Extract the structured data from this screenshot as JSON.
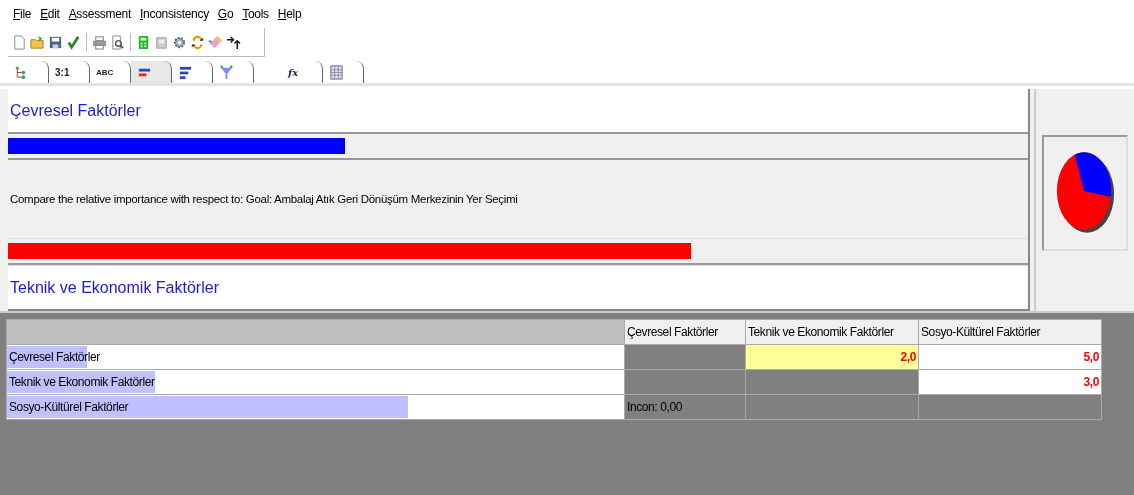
{
  "menu": [
    {
      "label": "File"
    },
    {
      "label": "Edit"
    },
    {
      "label": "Assessment"
    },
    {
      "label": "Inconsistency"
    },
    {
      "label": "Go"
    },
    {
      "label": "Tools"
    },
    {
      "label": "Help"
    }
  ],
  "toolbar": [
    {
      "kind": "new"
    },
    {
      "kind": "open"
    },
    {
      "kind": "save"
    },
    {
      "kind": "check"
    },
    {
      "kind": "print"
    },
    {
      "kind": "preview"
    },
    {
      "kind": "calc"
    },
    {
      "kind": "disk"
    },
    {
      "kind": "gears"
    },
    {
      "kind": "refresh"
    },
    {
      "kind": "eraser"
    },
    {
      "kind": "arrow"
    }
  ],
  "tabs": [
    {
      "kind": "tree",
      "selected": false
    },
    {
      "kind": "ratio",
      "label": "3:1",
      "selected": false
    },
    {
      "kind": "abc",
      "label": "ABC",
      "selected": false
    },
    {
      "kind": "bars",
      "selected": true
    },
    {
      "kind": "hbars",
      "selected": false
    },
    {
      "kind": "funnel",
      "selected": false
    },
    {
      "kind": "fx",
      "label": "fx",
      "selected": false
    },
    {
      "kind": "grid",
      "selected": false
    }
  ],
  "comparison": {
    "left": {
      "title": "Çevresel Faktörler",
      "level": 0.33
    },
    "prompt": "Compare the relative importance with respect to: Goal: Ambalaj Atık Geri Dönüşüm Merkezinin Yer Seçimi",
    "right": {
      "title": "Teknik ve Ekonomik Faktörler",
      "level": 0.67
    }
  },
  "table": {
    "columns": [
      "Çevresel Faktörler",
      "Teknik ve Ekonomik Faktörler",
      "Sosyo-Kültürel Faktörler"
    ],
    "rows": [
      {
        "label": "Çevresel Faktörler",
        "level": 0.13,
        "cells": [
          {
            "kind": "blank"
          },
          {
            "kind": "value",
            "text": "2,0",
            "selected": true
          },
          {
            "kind": "value",
            "text": "5,0",
            "selected": false
          }
        ]
      },
      {
        "label": "Teknik ve Ekonomik Faktörler",
        "level": 0.24,
        "cells": [
          {
            "kind": "blank"
          },
          {
            "kind": "blank"
          },
          {
            "kind": "value",
            "text": "3,0",
            "selected": false
          }
        ]
      },
      {
        "label": "Sosyo-Kültürel Faktörler",
        "level": 0.65,
        "cells": [
          {
            "kind": "note",
            "text": "Incon: 0,00"
          },
          {
            "kind": "blank"
          },
          {
            "kind": "blank"
          }
        ]
      }
    ]
  }
}
